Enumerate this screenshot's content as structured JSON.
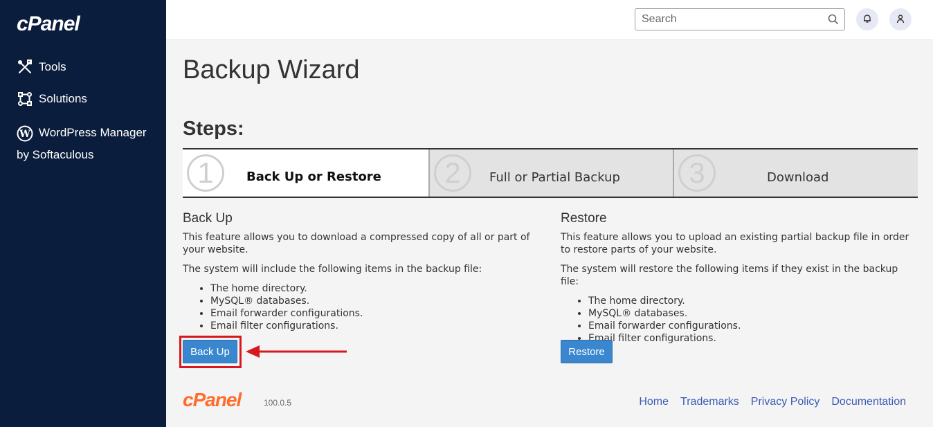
{
  "sidebar": {
    "logo": "cPanel",
    "items": [
      {
        "label": "Tools",
        "icon": "tools-icon"
      },
      {
        "label": "Solutions",
        "icon": "solutions-icon"
      },
      {
        "label": "WordPress Manager by Softaculous",
        "icon": "wordpress-icon"
      }
    ]
  },
  "topbar": {
    "search_placeholder": "Search",
    "icons": [
      "search-icon",
      "bell-icon",
      "user-icon"
    ]
  },
  "main": {
    "title": "Backup Wizard",
    "steps_title": "Steps:",
    "steps": [
      {
        "number": "1",
        "label": "Back Up or Restore",
        "active": true
      },
      {
        "number": "2",
        "label": "Full or Partial Backup",
        "active": false
      },
      {
        "number": "3",
        "label": "Download",
        "active": false
      }
    ],
    "backup": {
      "heading": "Back Up",
      "description": "This feature allows you to download a compressed copy of all or part of your website.",
      "intro": "The system will include the following items in the backup file:",
      "items": [
        "The home directory.",
        "MySQL® databases.",
        "Email forwarder configurations.",
        "Email filter configurations."
      ],
      "button": "Back Up"
    },
    "restore": {
      "heading": "Restore",
      "description": "This feature allows you to upload an existing partial backup file in order to restore parts of your website.",
      "intro": "The system will restore the following items if they exist in the backup file:",
      "items": [
        "The home directory.",
        "MySQL® databases.",
        "Email forwarder configurations.",
        "Email filter configurations."
      ],
      "button": "Restore"
    }
  },
  "footer": {
    "logo": "cPanel",
    "version": "100.0.5",
    "links": [
      "Home",
      "Trademarks",
      "Privacy Policy",
      "Documentation"
    ]
  },
  "colors": {
    "sidebar_bg": "#0b1d3c",
    "button_bg": "#3b87cf",
    "highlight": "#d6191f",
    "footer_logo": "#ff6c2c",
    "link": "#3d5bb5"
  }
}
